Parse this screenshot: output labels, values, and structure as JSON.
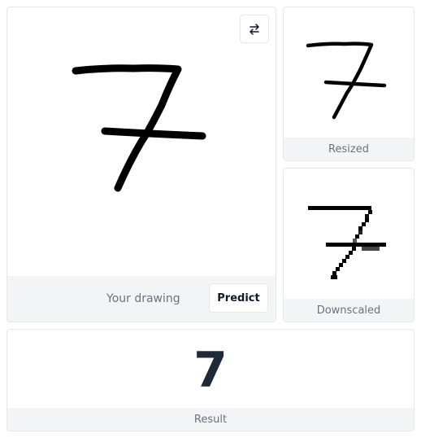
{
  "drawing": {
    "label": "Your drawing",
    "predict_label": "Predict",
    "swap_icon": "swap-arrows-icon"
  },
  "resized": {
    "label": "Resized"
  },
  "downscaled": {
    "label": "Downscaled"
  },
  "result": {
    "label": "Result",
    "value": "7"
  },
  "colors": {
    "panel_border": "#e5e7eb",
    "footer_bg": "#f3f4f6",
    "footer_text": "#6b7280",
    "stroke": "#000000",
    "result_text": "#1f2937"
  }
}
